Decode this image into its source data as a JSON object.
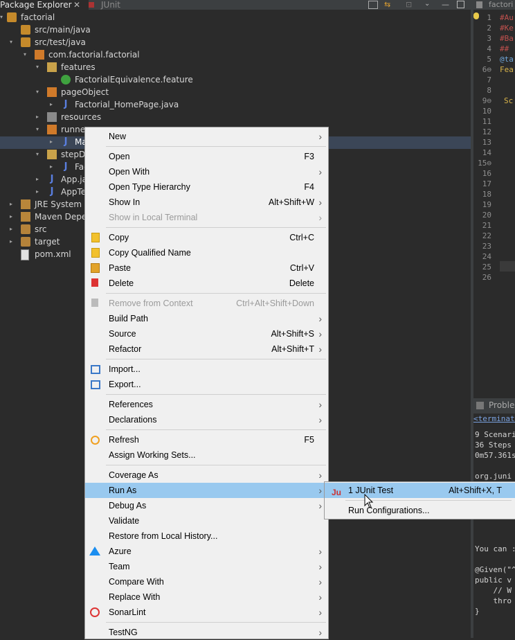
{
  "tabs": {
    "package_explorer": "Package Explorer",
    "junit": "JUnit"
  },
  "tree": [
    {
      "label": "factorial"
    },
    {
      "label": "src/main/java"
    },
    {
      "label": "src/test/java"
    },
    {
      "label": "com.factorial.factorial"
    },
    {
      "label": "features"
    },
    {
      "label": "FactorialEquivalence.feature"
    },
    {
      "label": "pageObject"
    },
    {
      "label": "Factorial_HomePage.java"
    },
    {
      "label": "resources"
    },
    {
      "label": "runner"
    },
    {
      "label": "Ma"
    },
    {
      "label": "stepDe"
    },
    {
      "label": "Fac"
    },
    {
      "label": "App.ja"
    },
    {
      "label": "AppTe"
    },
    {
      "label": "JRE System Li"
    },
    {
      "label": "Maven Depen"
    },
    {
      "label": "src"
    },
    {
      "label": "target"
    },
    {
      "label": "pom.xml"
    }
  ],
  "editor": {
    "tab": "factori",
    "lines": [
      {
        "n": "1",
        "t": "#Au"
      },
      {
        "n": "2",
        "t": "#Ke"
      },
      {
        "n": "3",
        "t": "#Ba"
      },
      {
        "n": "4",
        "t": "##"
      },
      {
        "n": "5",
        "t": "@ta"
      },
      {
        "n": "6⊖",
        "t": "Fea"
      },
      {
        "n": "7",
        "t": ""
      },
      {
        "n": "8",
        "t": ""
      },
      {
        "n": "9⊖",
        "t": "Sc"
      },
      {
        "n": "10",
        "t": ""
      },
      {
        "n": "11",
        "t": ""
      },
      {
        "n": "12",
        "t": ""
      },
      {
        "n": "13",
        "t": ""
      },
      {
        "n": "14",
        "t": ""
      },
      {
        "n": "15⊖",
        "t": ""
      },
      {
        "n": "16",
        "t": ""
      },
      {
        "n": "17",
        "t": ""
      },
      {
        "n": "18",
        "t": ""
      },
      {
        "n": "19",
        "t": ""
      },
      {
        "n": "20",
        "t": ""
      },
      {
        "n": "21",
        "t": ""
      },
      {
        "n": "22",
        "t": ""
      },
      {
        "n": "23",
        "t": ""
      },
      {
        "n": "24",
        "t": ""
      },
      {
        "n": "25",
        "t": ""
      },
      {
        "n": "26",
        "t": ""
      }
    ]
  },
  "console": {
    "tab": "Probler",
    "terminated": "<terminate",
    "lines": [
      "9 Scenari",
      "36 Steps",
      "0m57.361s",
      "",
      "org.juni",
      "",
      "",
      "",
      "",
      "",
      "",
      "You can :",
      "",
      "@Given(\"^",
      "public v",
      "    // W",
      "    thro",
      "}"
    ]
  },
  "menu": {
    "items": [
      {
        "label": "New",
        "sc": "",
        "arrow": true
      },
      {
        "sep": true
      },
      {
        "label": "Open",
        "sc": "F3"
      },
      {
        "label": "Open With",
        "sc": "",
        "arrow": true
      },
      {
        "label": "Open Type Hierarchy",
        "sc": "F4"
      },
      {
        "label": "Show In",
        "sc": "Alt+Shift+W",
        "arrow": true
      },
      {
        "label": "Show in Local Terminal",
        "sc": "",
        "arrow": true,
        "disabled": true
      },
      {
        "sep": true
      },
      {
        "label": "Copy",
        "sc": "Ctrl+C",
        "icon": "copy"
      },
      {
        "label": "Copy Qualified Name",
        "sc": "",
        "icon": "copy"
      },
      {
        "label": "Paste",
        "sc": "Ctrl+V",
        "icon": "paste"
      },
      {
        "label": "Delete",
        "sc": "Delete",
        "icon": "delete"
      },
      {
        "sep": true
      },
      {
        "label": "Remove from Context",
        "sc": "Ctrl+Alt+Shift+Down",
        "disabled": true,
        "icon": "remove"
      },
      {
        "label": "Build Path",
        "sc": "",
        "arrow": true
      },
      {
        "label": "Source",
        "sc": "Alt+Shift+S",
        "arrow": true
      },
      {
        "label": "Refactor",
        "sc": "Alt+Shift+T",
        "arrow": true
      },
      {
        "sep": true
      },
      {
        "label": "Import...",
        "sc": "",
        "icon": "import"
      },
      {
        "label": "Export...",
        "sc": "",
        "icon": "export"
      },
      {
        "sep": true
      },
      {
        "label": "References",
        "sc": "",
        "arrow": true
      },
      {
        "label": "Declarations",
        "sc": "",
        "arrow": true
      },
      {
        "sep": true
      },
      {
        "label": "Refresh",
        "sc": "F5",
        "icon": "refresh"
      },
      {
        "label": "Assign Working Sets...",
        "sc": ""
      },
      {
        "sep": true
      },
      {
        "label": "Coverage As",
        "sc": "",
        "arrow": true
      },
      {
        "label": "Run As",
        "sc": "",
        "arrow": true,
        "highlight": true
      },
      {
        "label": "Debug As",
        "sc": "",
        "arrow": true
      },
      {
        "label": "Validate",
        "sc": ""
      },
      {
        "label": "Restore from Local History...",
        "sc": ""
      },
      {
        "label": "Azure",
        "sc": "",
        "arrow": true,
        "icon": "azure"
      },
      {
        "label": "Team",
        "sc": "",
        "arrow": true
      },
      {
        "label": "Compare With",
        "sc": "",
        "arrow": true
      },
      {
        "label": "Replace With",
        "sc": "",
        "arrow": true
      },
      {
        "label": "SonarLint",
        "sc": "",
        "arrow": true,
        "icon": "sonar"
      },
      {
        "sep": true
      },
      {
        "label": "TestNG",
        "sc": "",
        "arrow": true
      }
    ]
  },
  "submenu": {
    "items": [
      {
        "label": "1 JUnit Test",
        "sc": "Alt+Shift+X, T",
        "highlight": true
      },
      {
        "label": "Run Configurations...",
        "sc": ""
      }
    ]
  }
}
